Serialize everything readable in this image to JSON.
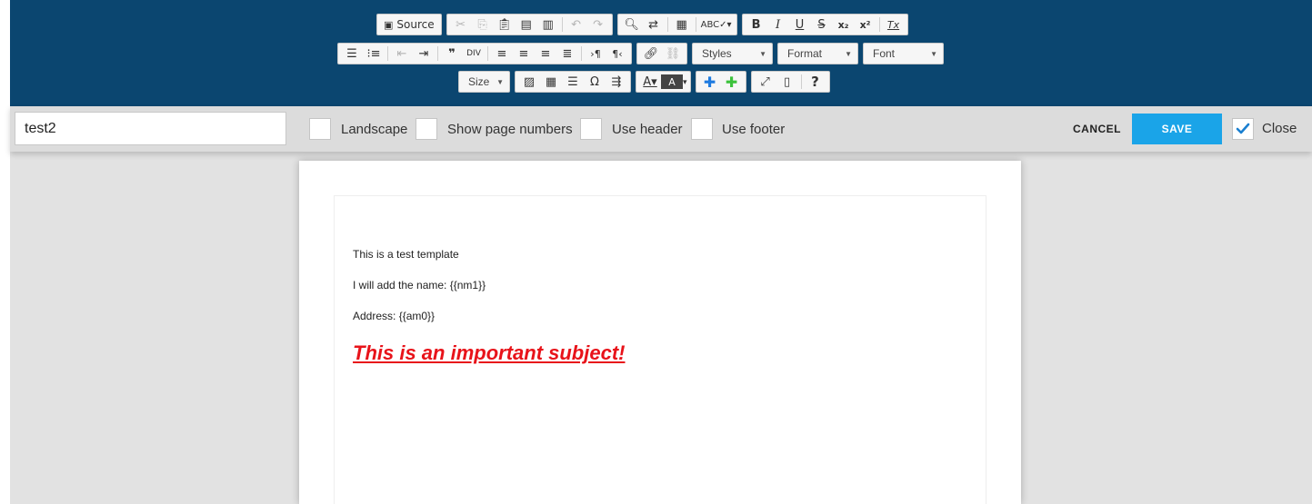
{
  "toolbar": {
    "row1": {
      "source_label": "Source",
      "bold": "B",
      "italic": "I",
      "underline": "U",
      "strike": "S",
      "subscript": "x₂",
      "superscript": "x²",
      "remove_format": "Tx"
    },
    "row2": {
      "styles": "Styles",
      "format": "Format",
      "font": "Font"
    },
    "row3": {
      "size": "Size",
      "omega": "Ω",
      "help": "?"
    }
  },
  "settings": {
    "template_name": "test2",
    "landscape_label": "Landscape",
    "page_numbers_label": "Show page numbers",
    "header_label": "Use header",
    "footer_label": "Use footer",
    "cancel_label": "CANCEL",
    "save_label": "SAVE",
    "close_label": "Close",
    "close_checked": true
  },
  "document": {
    "line1": "This is a test template",
    "line2": "I will add the name: {{nm1}}",
    "line3": "Address: {{am0}}",
    "subject": "This is an important subject!",
    "subject_color": "#e8131a"
  },
  "colors": {
    "toolbar_bg": "#0b4670",
    "save_bg": "#1aa4e8",
    "frame_bg": "#e2e2e2"
  }
}
